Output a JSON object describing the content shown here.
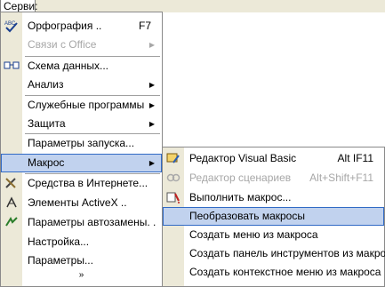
{
  "menubar": {
    "title": "Серви:"
  },
  "main_menu": {
    "items": [
      {
        "label": "Орфография ..",
        "shortcut": "F7",
        "icon": "spelling-icon",
        "disabled": false,
        "submenu": false
      },
      {
        "label": "Связи с Office",
        "shortcut": "",
        "icon": "",
        "disabled": true,
        "submenu": true
      },
      {
        "label": "Схема данных...",
        "shortcut": "",
        "icon": "relationships-icon",
        "disabled": false,
        "submenu": false
      },
      {
        "label": "Анализ",
        "shortcut": "",
        "icon": "",
        "disabled": false,
        "submenu": true
      },
      {
        "label": "Служебные программы",
        "shortcut": "",
        "icon": "",
        "disabled": false,
        "submenu": true
      },
      {
        "label": "Защита",
        "shortcut": "",
        "icon": "",
        "disabled": false,
        "submenu": true
      },
      {
        "label": "Параметры запуска...",
        "shortcut": "",
        "icon": "",
        "disabled": false,
        "submenu": false
      },
      {
        "label": "Макрос",
        "shortcut": "",
        "icon": "",
        "disabled": false,
        "submenu": true
      },
      {
        "label": "Средства в Интернете...",
        "shortcut": "",
        "icon": "tools-icon",
        "disabled": false,
        "submenu": false
      },
      {
        "label": "Элементы ActiveX ..",
        "shortcut": "",
        "icon": "activex-icon",
        "disabled": false,
        "submenu": false
      },
      {
        "label": "Параметры автозамены. .",
        "shortcut": "",
        "icon": "autocorrect-icon",
        "disabled": false,
        "submenu": false
      },
      {
        "label": "Настройка...",
        "shortcut": "",
        "icon": "",
        "disabled": false,
        "submenu": false
      },
      {
        "label": "Параметры...",
        "shortcut": "",
        "icon": "",
        "disabled": false,
        "submenu": false
      }
    ],
    "expand_glyph": "»"
  },
  "sub_menu": {
    "items": [
      {
        "label": "Редактор Visual Basic",
        "shortcut": "Alt IF11",
        "icon": "vb-editor-icon",
        "disabled": false
      },
      {
        "label": "Редактор сценариев",
        "shortcut": "Alt+Shift+F11",
        "icon": "script-editor-icon",
        "disabled": true
      },
      {
        "label": "Выполнить макрос...",
        "shortcut": "",
        "icon": "run-macro-icon",
        "disabled": false
      },
      {
        "label": "Пеобразовать макросы",
        "shortcut": "",
        "icon": "",
        "disabled": false
      },
      {
        "label": "Создать меню из макроса",
        "shortcut": "",
        "icon": "",
        "disabled": false
      },
      {
        "label": "Создать панель инструментов из макроса",
        "shortcut": "",
        "icon": "",
        "disabled": false
      },
      {
        "label": "Создать контекстное меню из макроса",
        "shortcut": "",
        "icon": "",
        "disabled": false
      }
    ]
  },
  "colors": {
    "highlight_bg": "#c1d2ee",
    "highlight_border": "#316ac5",
    "gutter": "#ece9d8"
  }
}
